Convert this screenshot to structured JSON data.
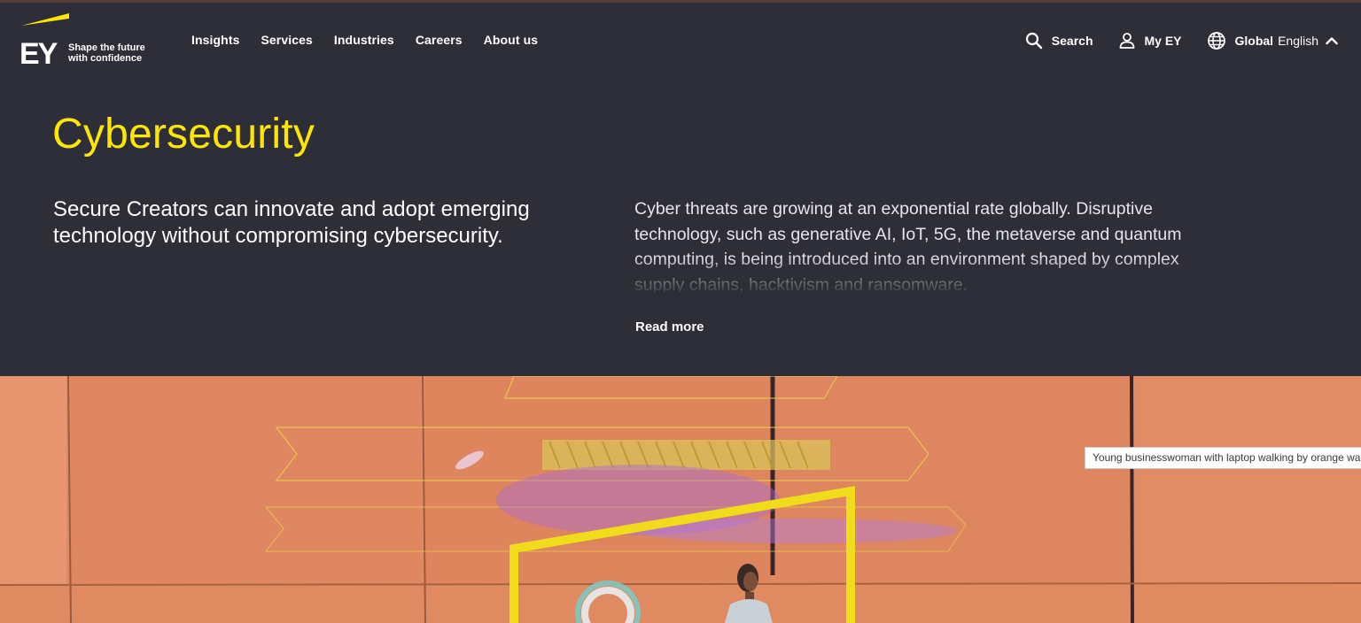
{
  "header": {
    "logo": {
      "mark": "EY",
      "tagline_line1": "Shape the future",
      "tagline_line2": "with confidence"
    },
    "nav": [
      {
        "label": "Insights"
      },
      {
        "label": "Services"
      },
      {
        "label": "Industries"
      },
      {
        "label": "Careers"
      },
      {
        "label": "About us"
      }
    ],
    "utilities": {
      "search_label": "Search",
      "myey_label": "My EY",
      "region_label": "Global",
      "language_label": "English"
    }
  },
  "hero": {
    "title": "Cybersecurity",
    "lead": "Secure Creators can innovate and adopt emerging technology without compromising cybersecurity.",
    "body": "Cyber threats are growing at an exponential rate globally. Disruptive technology, such as generative AI, IoT, 5G, the metaverse and quantum computing, is being introduced into an environment shaped by complex supply chains, hacktivism and ransomware.",
    "read_more": "Read more"
  },
  "image": {
    "tooltip": "Young businesswoman with laptop walking by orange wall"
  },
  "colors": {
    "background": "#2e2e38",
    "accent_yellow": "#ffe600",
    "image_orange": "#e08960"
  },
  "icons": [
    "search-icon",
    "user-icon",
    "globe-icon",
    "chevron-up-icon"
  ]
}
